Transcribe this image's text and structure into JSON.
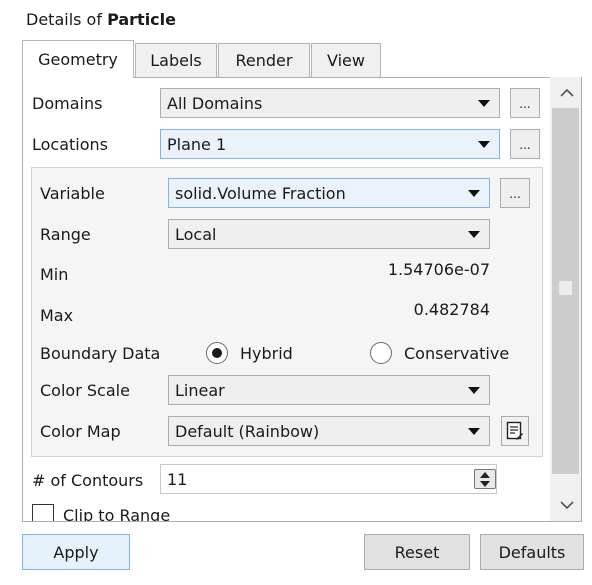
{
  "title": {
    "prefix": "Details of ",
    "object": "Particle"
  },
  "tabs": [
    {
      "label": "Geometry",
      "active": true
    },
    {
      "label": "Labels",
      "active": false
    },
    {
      "label": "Render",
      "active": false
    },
    {
      "label": "View",
      "active": false
    }
  ],
  "domains": {
    "label": "Domains",
    "value": "All Domains",
    "more": "..."
  },
  "locations": {
    "label": "Locations",
    "value": "Plane 1",
    "more": "..."
  },
  "variable": {
    "label": "Variable",
    "value": "solid.Volume Fraction",
    "more": "..."
  },
  "range": {
    "label": "Range",
    "value": "Local"
  },
  "min": {
    "label": "Min",
    "value": "1.54706e-07"
  },
  "max": {
    "label": "Max",
    "value": "0.482784"
  },
  "boundary_data": {
    "label": "Boundary Data",
    "options": [
      "Hybrid",
      "Conservative"
    ],
    "selected": "Hybrid"
  },
  "color_scale": {
    "label": "Color Scale",
    "value": "Linear"
  },
  "color_map": {
    "label": "Color Map",
    "value": "Default (Rainbow)"
  },
  "contours": {
    "label": "# of Contours",
    "value": "11"
  },
  "clip": {
    "label": "Clip to Range",
    "checked": false
  },
  "buttons": {
    "apply": "Apply",
    "reset": "Reset",
    "defaults": "Defaults"
  },
  "icons": {
    "scroll_up": "chevron-up-icon",
    "scroll_down": "chevron-down-icon",
    "dropdown": "triangle-down-icon",
    "editor": "edit-document-icon"
  },
  "colors": {
    "focus_border": "#7eb4ea",
    "panel_border": "#adadad"
  }
}
